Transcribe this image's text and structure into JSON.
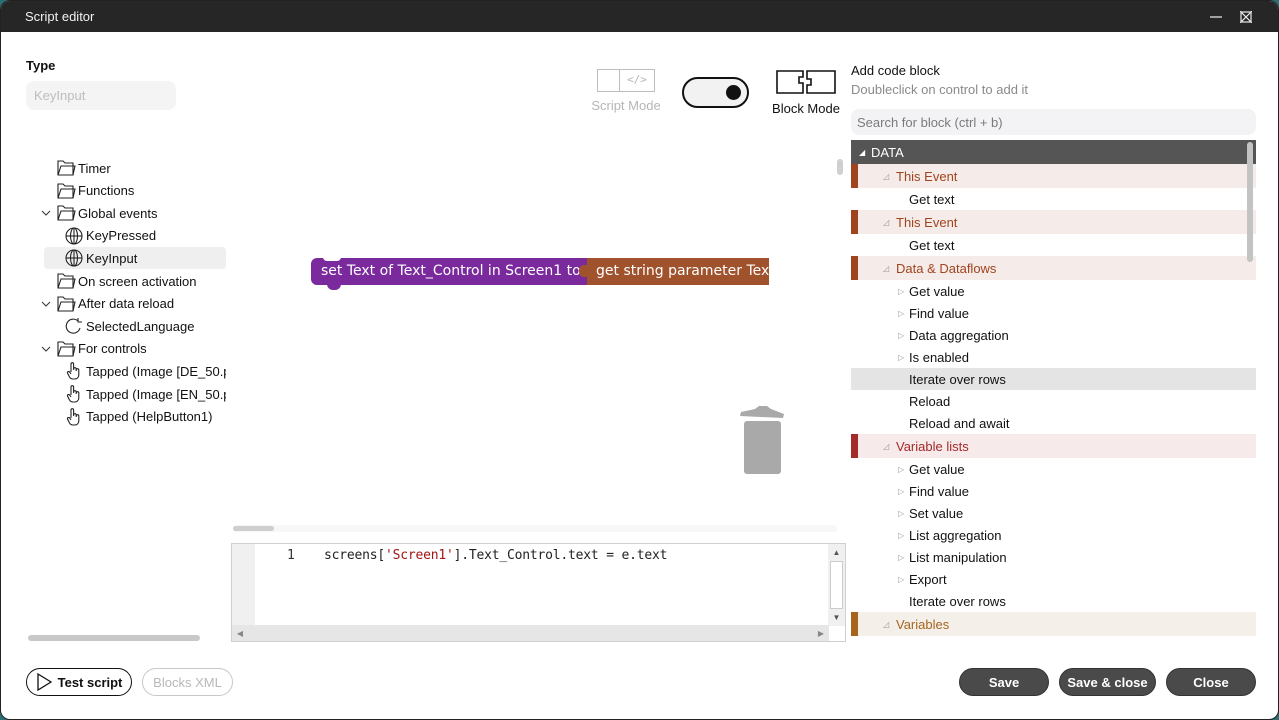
{
  "window": {
    "title": "Script editor",
    "controls": [
      "minimize",
      "maximize",
      "close"
    ]
  },
  "type_field": {
    "label": "Type",
    "value": "KeyInput"
  },
  "tree": {
    "items": [
      {
        "label": "Timer",
        "icon": "folder-icon",
        "expanded": null,
        "level": 0
      },
      {
        "label": "Functions",
        "icon": "folder-icon",
        "expanded": null,
        "level": 0
      },
      {
        "label": "Global events",
        "icon": "folder-icon",
        "expanded": true,
        "level": 0
      },
      {
        "label": "KeyPressed",
        "icon": "globe-icon",
        "level": 1
      },
      {
        "label": "KeyInput",
        "icon": "globe-icon",
        "level": 1,
        "selected": true
      },
      {
        "label": "On screen activation",
        "icon": "folder-icon",
        "expanded": null,
        "level": 0
      },
      {
        "label": "After data reload",
        "icon": "folder-icon",
        "expanded": true,
        "level": 0
      },
      {
        "label": "SelectedLanguage",
        "icon": "reload-icon",
        "level": 1
      },
      {
        "label": "For controls",
        "icon": "folder-icon",
        "expanded": true,
        "level": 0
      },
      {
        "label": "Tapped (Image [DE_50.p",
        "icon": "hand-pointer-icon",
        "level": 1
      },
      {
        "label": "Tapped (Image [EN_50.p",
        "icon": "hand-pointer-icon",
        "level": 1
      },
      {
        "label": "Tapped (HelpButton1)",
        "icon": "hand-pointer-icon",
        "level": 1
      }
    ]
  },
  "mode": {
    "script_mode_label": "Script Mode",
    "block_mode_label": "Block Mode",
    "active": "Block Mode"
  },
  "blocks": {
    "set_block": "set Text of Text_Control in Screen1 to",
    "get_block": "get string parameter Text",
    "set_color": "#7b2a9e",
    "get_color": "#a0522d"
  },
  "code": {
    "line_number": "1",
    "prefix": "screens[",
    "string": "'Screen1'",
    "suffix": "].Text_Control.text = e.text"
  },
  "palette_panel": {
    "title": "Add code block",
    "subtitle": "Doubleclick on control to add it",
    "search_placeholder": "Search for block (ctrl + b)",
    "rows": [
      {
        "type": "head",
        "label": "DATA"
      },
      {
        "type": "cat",
        "label": "This Event",
        "color": "#a0441f",
        "bg": "#f5ebe8"
      },
      {
        "type": "item",
        "label": "Get text",
        "expandable": false
      },
      {
        "type": "cat",
        "label": "This Event",
        "color": "#a0441f",
        "bg": "#f5ebe8"
      },
      {
        "type": "item",
        "label": "Get text",
        "expandable": false
      },
      {
        "type": "cat",
        "label": "Data & Dataflows",
        "color": "#a0441f",
        "bg": "#f5ebe8"
      },
      {
        "type": "item",
        "label": "Get value",
        "expandable": true
      },
      {
        "type": "item",
        "label": "Find value",
        "expandable": true
      },
      {
        "type": "item",
        "label": "Data aggregation",
        "expandable": true
      },
      {
        "type": "item",
        "label": "Is enabled",
        "expandable": true
      },
      {
        "type": "item",
        "label": "Iterate over rows",
        "expandable": false,
        "hover": true
      },
      {
        "type": "item",
        "label": "Reload",
        "expandable": false
      },
      {
        "type": "item",
        "label": "Reload and await",
        "expandable": false
      },
      {
        "type": "cat",
        "label": "Variable lists",
        "color": "#a52a2a",
        "bg": "#f6eaea"
      },
      {
        "type": "item",
        "label": "Get value",
        "expandable": true
      },
      {
        "type": "item",
        "label": "Find value",
        "expandable": true
      },
      {
        "type": "item",
        "label": "Set value",
        "expandable": true
      },
      {
        "type": "item",
        "label": "List aggregation",
        "expandable": true
      },
      {
        "type": "item",
        "label": "List manipulation",
        "expandable": true
      },
      {
        "type": "item",
        "label": "Export",
        "expandable": true
      },
      {
        "type": "item",
        "label": "Iterate over rows",
        "expandable": false
      },
      {
        "type": "cat",
        "label": "Variables",
        "color": "#a5651f",
        "bg": "#f4efe9"
      }
    ]
  },
  "footer": {
    "test_script": "Test script",
    "blocks_xml": "Blocks XML",
    "save": "Save",
    "save_close": "Save & close",
    "close": "Close"
  }
}
